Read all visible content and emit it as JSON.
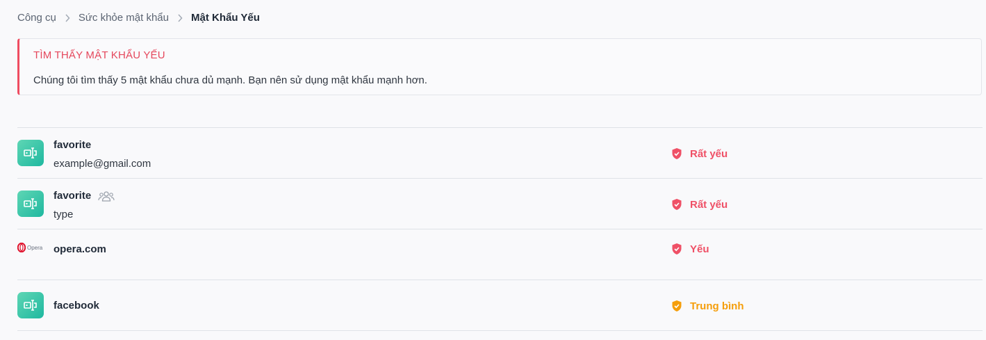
{
  "breadcrumb": {
    "items": [
      "Công cụ",
      "Sức khỏe mật khẩu"
    ],
    "current": "Mật Khẩu Yếu"
  },
  "alert": {
    "title": "TÌM THẤY MẬT KHẨU YẾU",
    "message": "Chúng tôi tìm thấy 5 mật khẩu chưa dủ mạnh. Bạn nên sử dụng mật khẩu mạnh hơn."
  },
  "items": [
    {
      "name": "favorite",
      "subtitle": "example@gmail.com",
      "strength": "Rất yếu",
      "icon": "app-icon",
      "shared": false
    },
    {
      "name": "favorite",
      "subtitle": "type",
      "strength": "Rất yếu",
      "icon": "app-icon",
      "shared": true
    },
    {
      "name": "opera.com",
      "subtitle": "",
      "strength": "Yếu",
      "icon": "opera-logo",
      "logo_text": "Opera",
      "shared": false
    },
    {
      "name": "facebook",
      "subtitle": "",
      "strength": "Trung bình",
      "icon": "app-icon",
      "shared": false
    }
  ],
  "colors": {
    "weak": "#ef5066",
    "medium": "#f59e0b",
    "accent_border": "#ef4c61",
    "icon_gradient_start": "#5ed6b4",
    "icon_gradient_end": "#1fb8a0"
  }
}
